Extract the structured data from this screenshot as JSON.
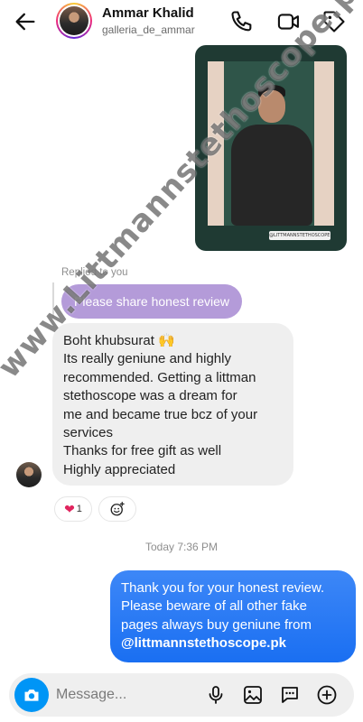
{
  "header": {
    "name": "Ammar Khalid",
    "handle": "galleria_de_ammar",
    "icons": [
      "back-arrow-icon",
      "phone-icon",
      "video-icon",
      "tag-icon"
    ]
  },
  "shared_photo": {
    "caption": "@LITTMANNSTETHOSCOPE.PK"
  },
  "reply": {
    "context_label": "Replied to you",
    "quoted_text": "Please share honest review"
  },
  "incoming_message": {
    "lines": [
      "Boht khubsurat 🙌",
      "Its really geniune and highly",
      "recommended. Getting a littman",
      "stethoscope was a dream for",
      "me and became true bcz of your",
      "services",
      "Thanks for free gift as well",
      "Highly appreciated"
    ]
  },
  "reaction": {
    "emoji": "❤",
    "count": "1"
  },
  "timestamp": "Today 7:36 PM",
  "outgoing_message": {
    "lines": [
      "Thank you for your honest review.",
      "Please beware of all other fake",
      "pages always buy geniune from"
    ],
    "link": "@littmannstethoscope.pk"
  },
  "composer": {
    "placeholder": "Message..."
  },
  "watermark": "www.Littmannstethoscope.pk",
  "colors": {
    "accent_blue": "#0095f6",
    "outgoing_bubble": "#3d87f7",
    "reply_bubble": "#b49bd9",
    "incoming_bubble": "#efefef"
  }
}
